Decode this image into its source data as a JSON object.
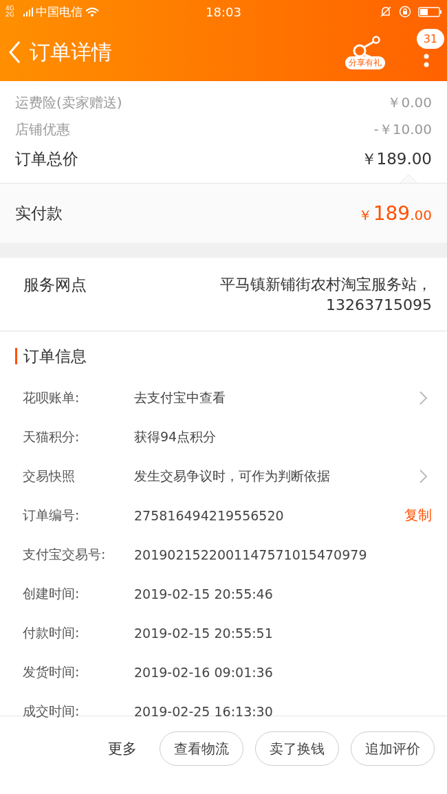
{
  "status_bar": {
    "network": "4G 2G",
    "carrier": "中国电信",
    "time": "18:03"
  },
  "header": {
    "title": "订单详情",
    "share_label": "分享有礼",
    "badge": "31"
  },
  "price_rows": [
    {
      "kind": "minor",
      "label": "运费险(卖家赠送)",
      "value": "￥0.00"
    },
    {
      "kind": "minor",
      "label": "店铺优惠",
      "value": "-￥10.00"
    },
    {
      "kind": "total",
      "label": "订单总价",
      "value": "￥189.00"
    }
  ],
  "paid": {
    "label": "实付款",
    "currency": "￥",
    "integer": "189",
    "decimals": ".00"
  },
  "service": {
    "label": "服务网点",
    "value_lines": [
      "平马镇新铺街农村淘宝服务站，",
      "13263715095"
    ]
  },
  "order_info": {
    "title": "订单信息",
    "rows": [
      {
        "kind": "link",
        "label": "花呗账单:",
        "value": "去支付宝中查看"
      },
      {
        "kind": "plain",
        "label": "天猫积分:",
        "value": "获得94点积分"
      },
      {
        "kind": "link",
        "label": "交易快照",
        "value": "发生交易争议时，可作为判断依据"
      },
      {
        "kind": "copy",
        "label": "订单编号:",
        "value": "275816494219556520",
        "action_label": "复制"
      },
      {
        "kind": "plain",
        "label": "支付宝交易号:",
        "value": "2019021522001147571015470979"
      },
      {
        "kind": "plain",
        "label": "创建时间:",
        "value": "2019-02-15 20:55:46"
      },
      {
        "kind": "plain",
        "label": "付款时间:",
        "value": "2019-02-15 20:55:51"
      },
      {
        "kind": "plain",
        "label": "发货时间:",
        "value": "2019-02-16 09:01:36"
      },
      {
        "kind": "plain",
        "label": "成交时间:",
        "value": "2019-02-25 16:13:30"
      }
    ]
  },
  "bottom_bar": {
    "more": "更多",
    "buttons": [
      "查看物流",
      "卖了换钱",
      "追加评价"
    ]
  }
}
